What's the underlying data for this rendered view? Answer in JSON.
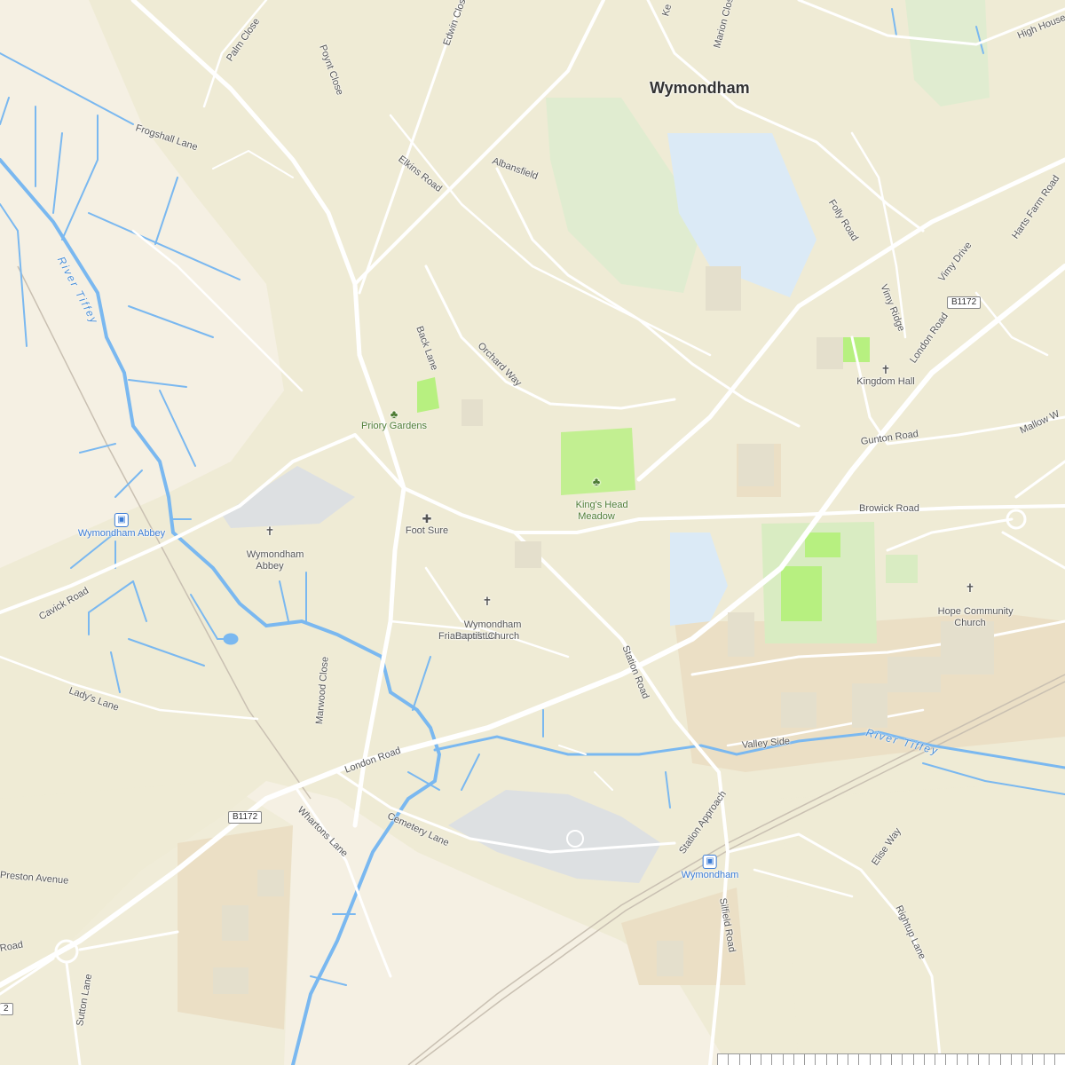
{
  "map": {
    "town": "Wymondham",
    "places": {
      "priory_gardens": "Priory Gardens",
      "kings_head_meadow": "King's Head\nMeadow",
      "wymondham_abbey": "Wymondham\nAbbey",
      "foot_sure": "Foot Sure",
      "baptist_church": "Wymondham\nBaptist Church",
      "kingdom_hall": "Kingdom Hall",
      "hope_church": "Hope Community\nChurch",
      "station_abbey": "Wymondham Abbey",
      "station_main": "Wymondham"
    },
    "roads": {
      "palm_close": "Palm Close",
      "poynt_close": "Poynt Close",
      "edwin_close": "Edwin Close",
      "marion_close": "Marion Close",
      "ke": "Ke",
      "high_house": "High House",
      "frogshall_lane": "Frogshall Lane",
      "elkins_road": "Elkins Road",
      "albansfield": "Albansfield",
      "folly_road": "Folly Road",
      "harts_farm_road": "Harts Farm Road",
      "vimy_drive": "Vimy Drive",
      "vimy_ridge": "Vimy Ridge",
      "london_road_ne": "London Road",
      "back_lane": "Back Lane",
      "orchard_way": "Orchard Way",
      "mallow_way": "Mallow W",
      "gunton_road": "Gunton Road",
      "browick_road": "Browick Road",
      "cavick_road": "Cavick Road",
      "friarscroft_ln": "Friarscroft Ln",
      "station_road": "Station Road",
      "ladys_lane": "Lady's Lane",
      "marwood_close": "Marwood Close",
      "valley_side": "Valley Side",
      "london_road_sw": "London Road",
      "whartons_lane": "Whartons Lane",
      "cemetery_lane": "Cemetery Lane",
      "station_approach": "Station Approach",
      "elise_way": "Elise Way",
      "preston_avenue": "Preston Avenue",
      "road_w": "Road",
      "silfield_road": "Silfield Road",
      "rightup_lane": "Rightup Lane",
      "sutton_lane": "Sutton Lane"
    },
    "shields": {
      "b1172_ne": "B1172",
      "b1172_sw": "B1172",
      "edge": "2"
    },
    "waterways": {
      "tiffey_nw": "River Tiffey",
      "tiffey_e": "River Tiffey"
    }
  },
  "colors": {
    "land": "#f5f0e3",
    "urban": "#efebd5",
    "road": "#ffffff",
    "water": "#7ab8f0",
    "park": "#d9ecc2",
    "grass": "#b7f080",
    "cemetery": "#dde0e2",
    "school": "#dbeaf6",
    "industrial": "#ebdfc5"
  }
}
